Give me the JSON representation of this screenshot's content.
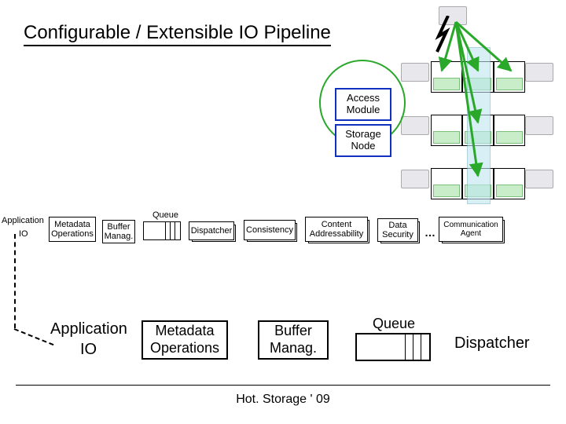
{
  "title": "Configurable / Extensible  IO Pipeline",
  "cluster": {
    "access_module": "Access\nModule",
    "storage_node": "Storage\nNode"
  },
  "pipeline_small": {
    "application": "Application",
    "io": "IO",
    "metadata_ops": "Metadata\nOperations",
    "buffer_manag": "Buffer\nManag.",
    "queue_label": "Queue",
    "dispatcher": "Dispatcher",
    "consistency": "Consistency",
    "content_addr": "Content\nAddressability",
    "data_security": "Data\nSecurity",
    "ellipsis": "…",
    "comm_agent": "Communication\nAgent"
  },
  "pipeline_big": {
    "application": "Application",
    "io": "IO",
    "metadata_ops": "Metadata\nOperations",
    "buffer_manag": "Buffer\nManag.",
    "queue_label": "Queue",
    "dispatcher": "Dispatcher"
  },
  "footer": "Hot. Storage ' 09"
}
